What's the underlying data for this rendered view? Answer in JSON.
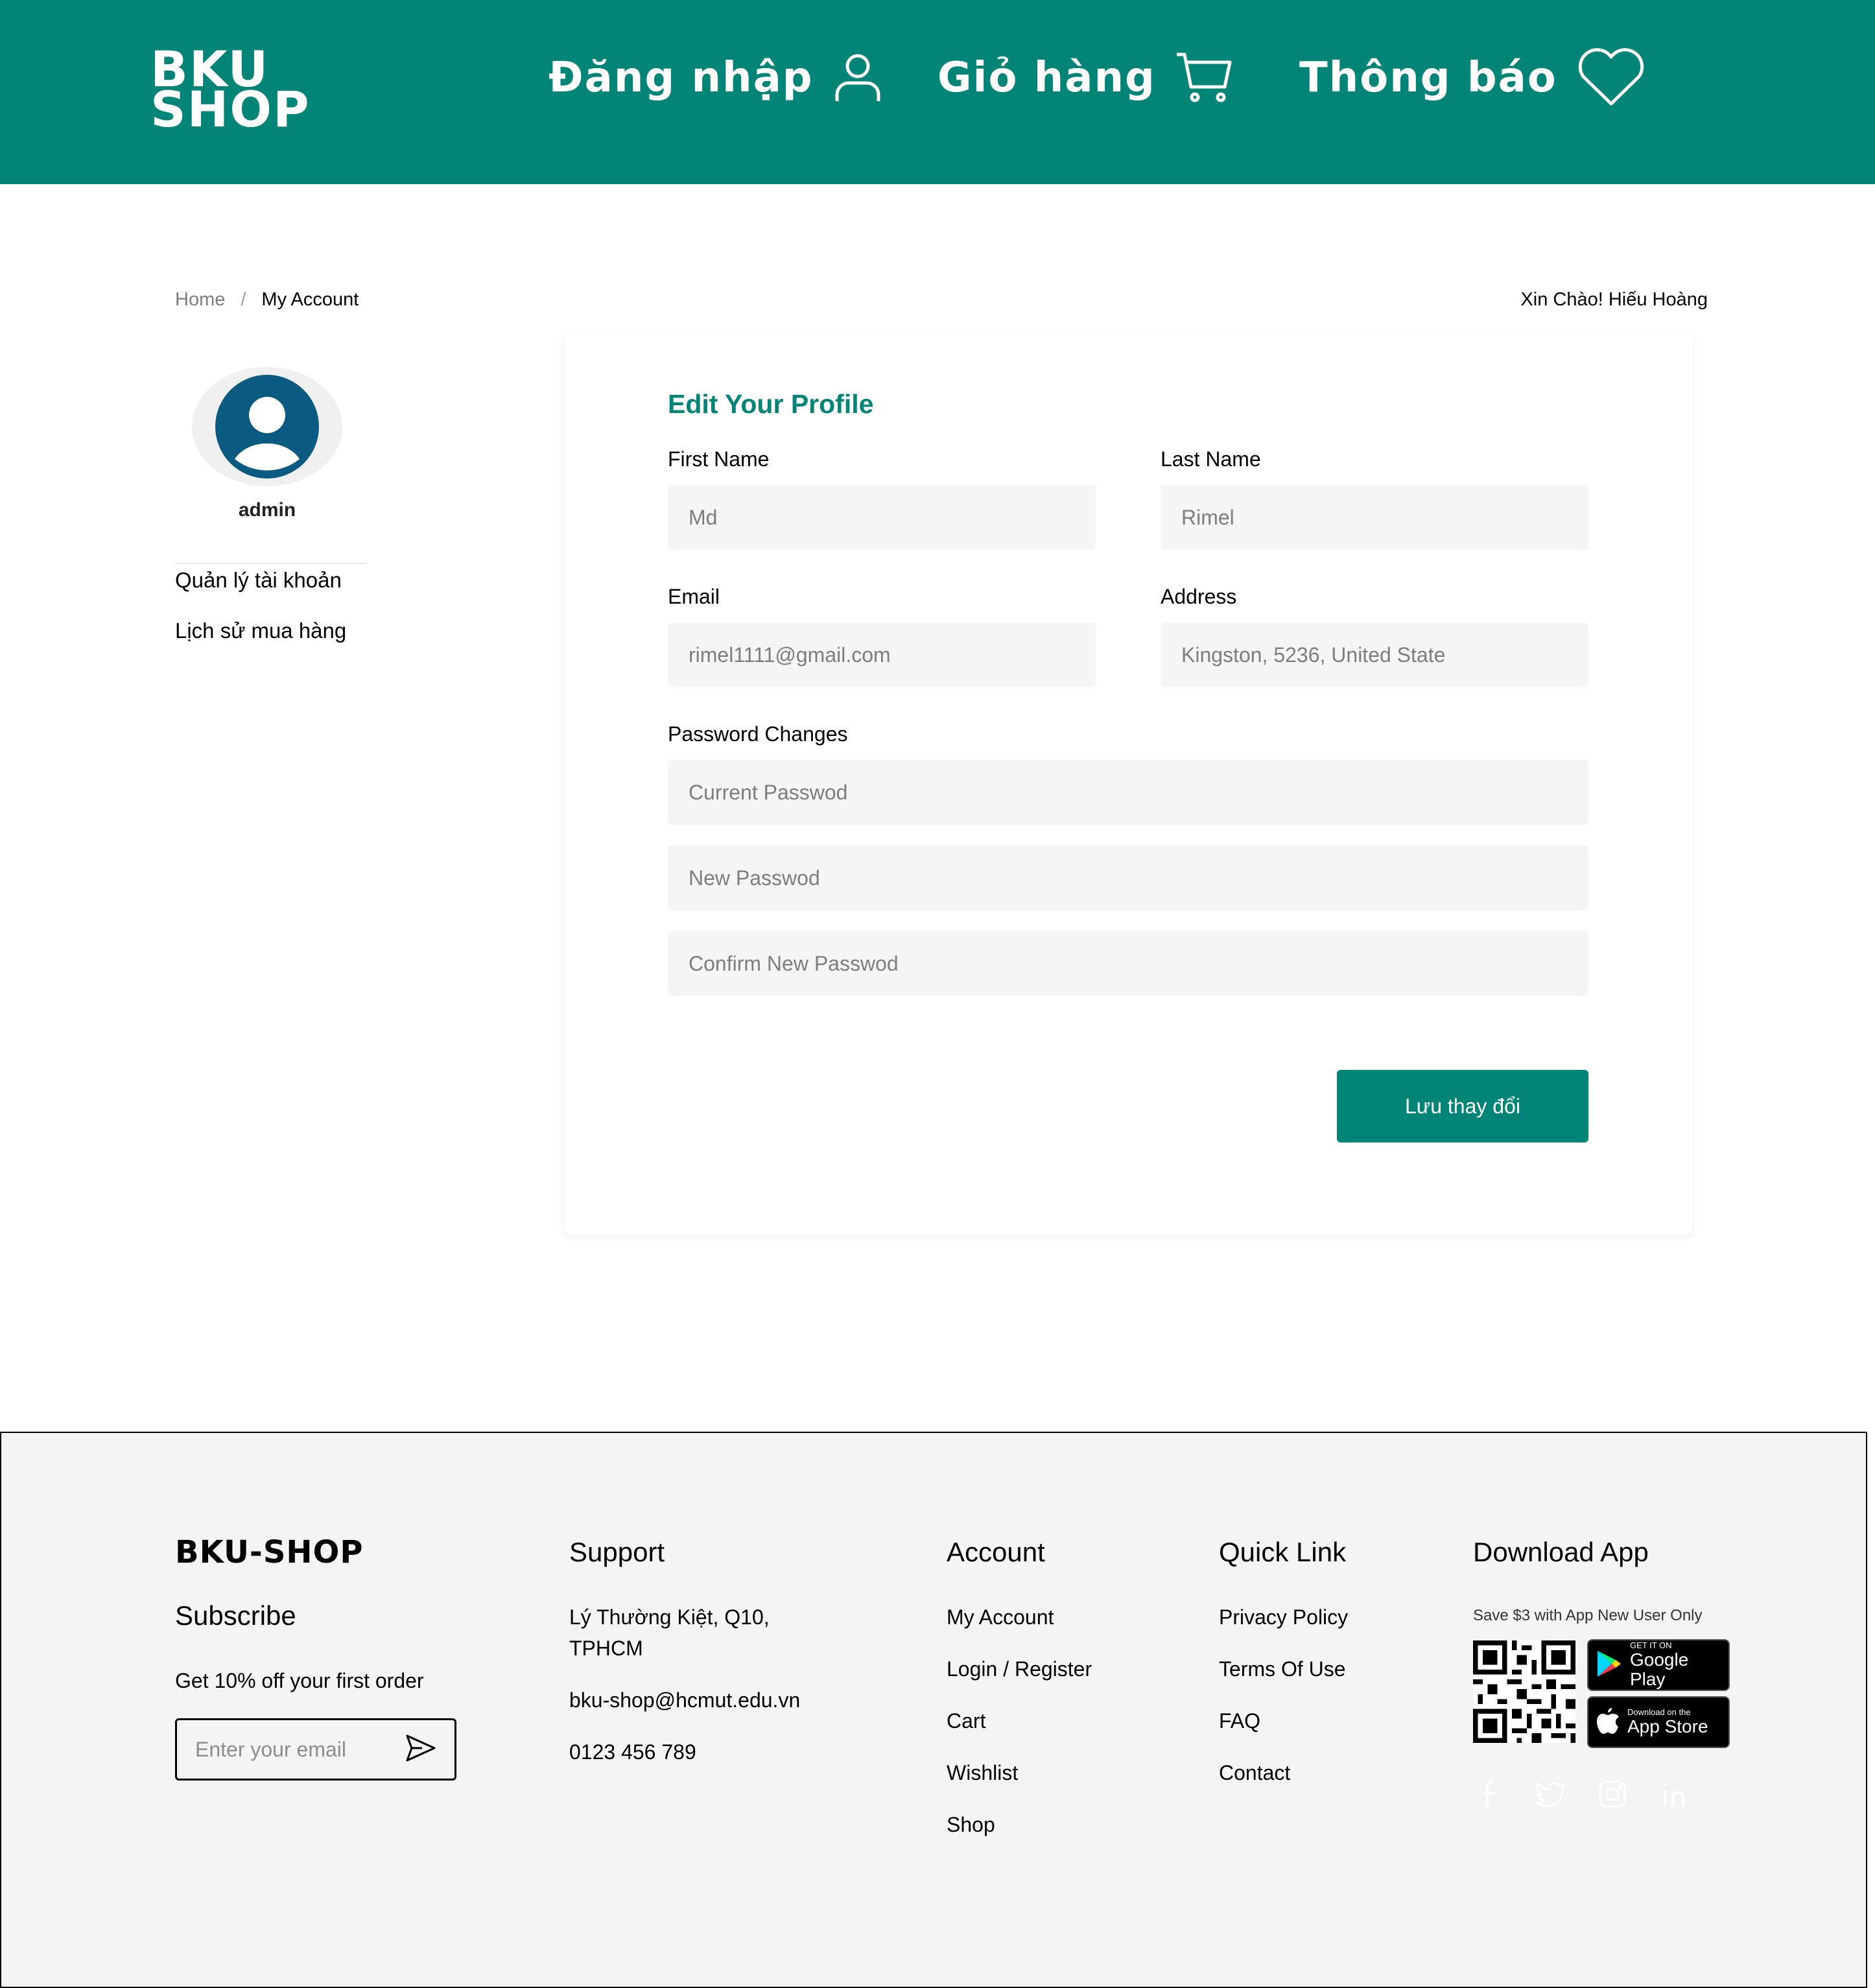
{
  "header": {
    "logo_line1": "BKU",
    "logo_line2": "SHOP",
    "nav": {
      "login": "Đăng nhập",
      "cart": "Giỏ hàng",
      "notifications": "Thông báo"
    },
    "brand_color": "#028576"
  },
  "breadcrumb": {
    "home": "Home",
    "separator": "/",
    "current": "My Account"
  },
  "greeting": "Xin Chào! Hiếu Hoàng",
  "sidebar": {
    "username": "admin",
    "links": [
      "Quản lý tài khoản",
      "Lịch sử mua hàng"
    ]
  },
  "profile": {
    "title": "Edit Your Profile",
    "first_name": {
      "label": "First Name",
      "placeholder": "Md"
    },
    "last_name": {
      "label": "Last Name",
      "placeholder": "Rimel"
    },
    "email": {
      "label": "Email",
      "placeholder": "rimel1111@gmail.com"
    },
    "address": {
      "label": "Address",
      "placeholder": "Kingston, 5236, United State"
    },
    "password_section": "Password Changes",
    "current_password": {
      "placeholder": "Current Passwod"
    },
    "new_password": {
      "placeholder": "New Passwod"
    },
    "confirm_password": {
      "placeholder": "Confirm New Passwod"
    },
    "save_label": "Lưu thay đổi"
  },
  "footer": {
    "brand": "BKU-SHOP",
    "subscribe_title": "Subscribe",
    "subscribe_offer": "Get 10% off your first order",
    "email_placeholder": "Enter your email",
    "support": {
      "title": "Support",
      "address_line1": "Lý Thường Kiệt, Q10,",
      "address_line2": "TPHCM",
      "email": "bku-shop@hcmut.edu.vn",
      "phone": "0123 456 789"
    },
    "account": {
      "title": "Account",
      "links": [
        "My Account",
        "Login / Register",
        "Cart",
        "Wishlist",
        "Shop"
      ]
    },
    "quick_link": {
      "title": "Quick Link",
      "links": [
        "Privacy Policy",
        "Terms Of Use",
        "FAQ",
        "Contact"
      ]
    },
    "download": {
      "title": "Download App",
      "promo": "Save $3 with App New User Only",
      "google_play_small": "GET IT ON",
      "google_play_big": "Google Play",
      "app_store_small": "Download on the",
      "app_store_big": "App Store"
    },
    "social_icons": [
      "facebook-icon",
      "twitter-icon",
      "instagram-icon",
      "linkedin-icon"
    ]
  }
}
